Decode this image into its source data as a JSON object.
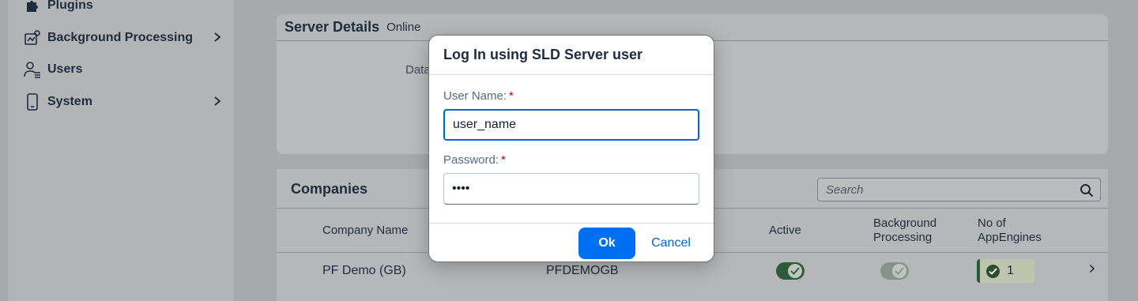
{
  "sidebar": {
    "items": [
      {
        "label": "Plugins",
        "icon": "puzzle-icon"
      },
      {
        "label": "Background Processing",
        "icon": "background-processing-icon"
      },
      {
        "label": "Users",
        "icon": "user-icon"
      },
      {
        "label": "System",
        "icon": "device-icon"
      }
    ]
  },
  "server": {
    "title": "Server Details",
    "status": "Online",
    "field_label": "Data"
  },
  "companies": {
    "title": "Companies",
    "search_placeholder": "Search",
    "columns": {
      "company_name": "Company Name",
      "active": "Active",
      "background_processing_line1": "Background",
      "background_processing_line2": "Processing",
      "appengines_line1": "No of",
      "appengines_line2": "AppEngines"
    },
    "rows": [
      {
        "company_name": "PF Demo (GB)",
        "code": "PFDEMOGB",
        "active": true,
        "background_processing": true,
        "appengines": "1"
      }
    ]
  },
  "dialog": {
    "title": "Log In using SLD Server user",
    "username_label": "User Name:",
    "username_value": "user_name",
    "password_label": "Password:",
    "password_value": "xxxx",
    "required_marker": "*",
    "ok_label": "Ok",
    "cancel_label": "Cancel"
  },
  "colors": {
    "accent": "#0070f2",
    "focus_border": "#0064d9",
    "required": "#aa0808",
    "positive": "#2b5a2e"
  }
}
